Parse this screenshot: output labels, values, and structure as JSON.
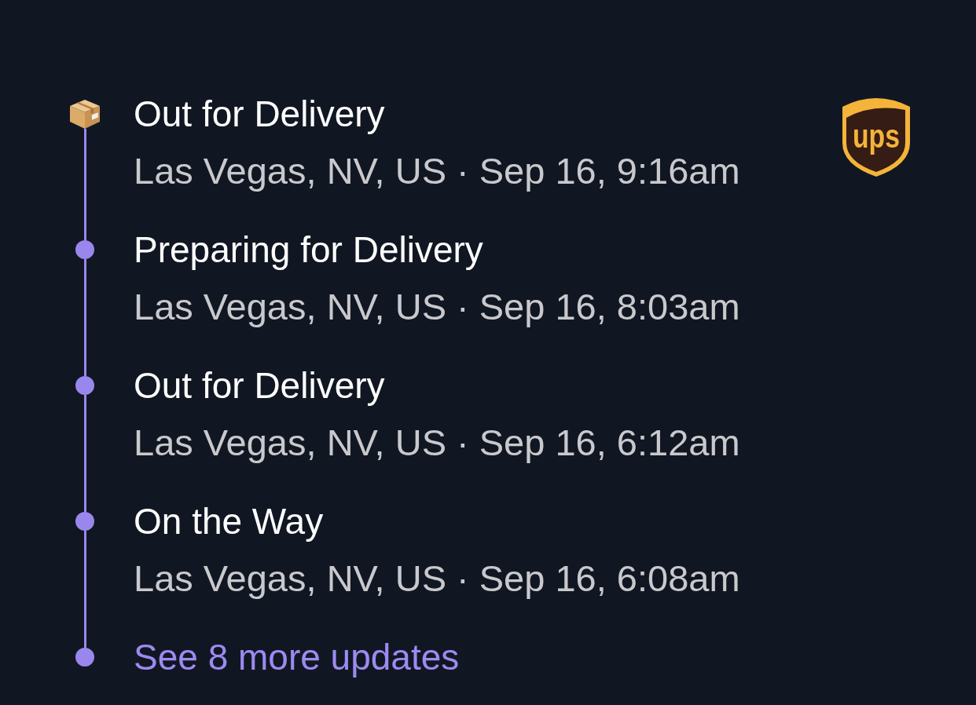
{
  "events": [
    {
      "kind": "package",
      "title": "Out for Delivery",
      "detail": "Las Vegas, NV, US · Sep 16, 9:16am"
    },
    {
      "kind": "dot",
      "title": "Preparing for Delivery",
      "detail": "Las Vegas, NV, US · Sep 16, 8:03am"
    },
    {
      "kind": "dot",
      "title": "Out for Delivery",
      "detail": "Las Vegas, NV, US · Sep 16, 6:12am"
    },
    {
      "kind": "dot",
      "title": "On the Way",
      "detail": "Las Vegas, NV, US · Sep 16, 6:08am"
    }
  ],
  "more_updates": {
    "label": "See 8 more updates"
  },
  "carrier_logo": {
    "text": "ups"
  }
}
